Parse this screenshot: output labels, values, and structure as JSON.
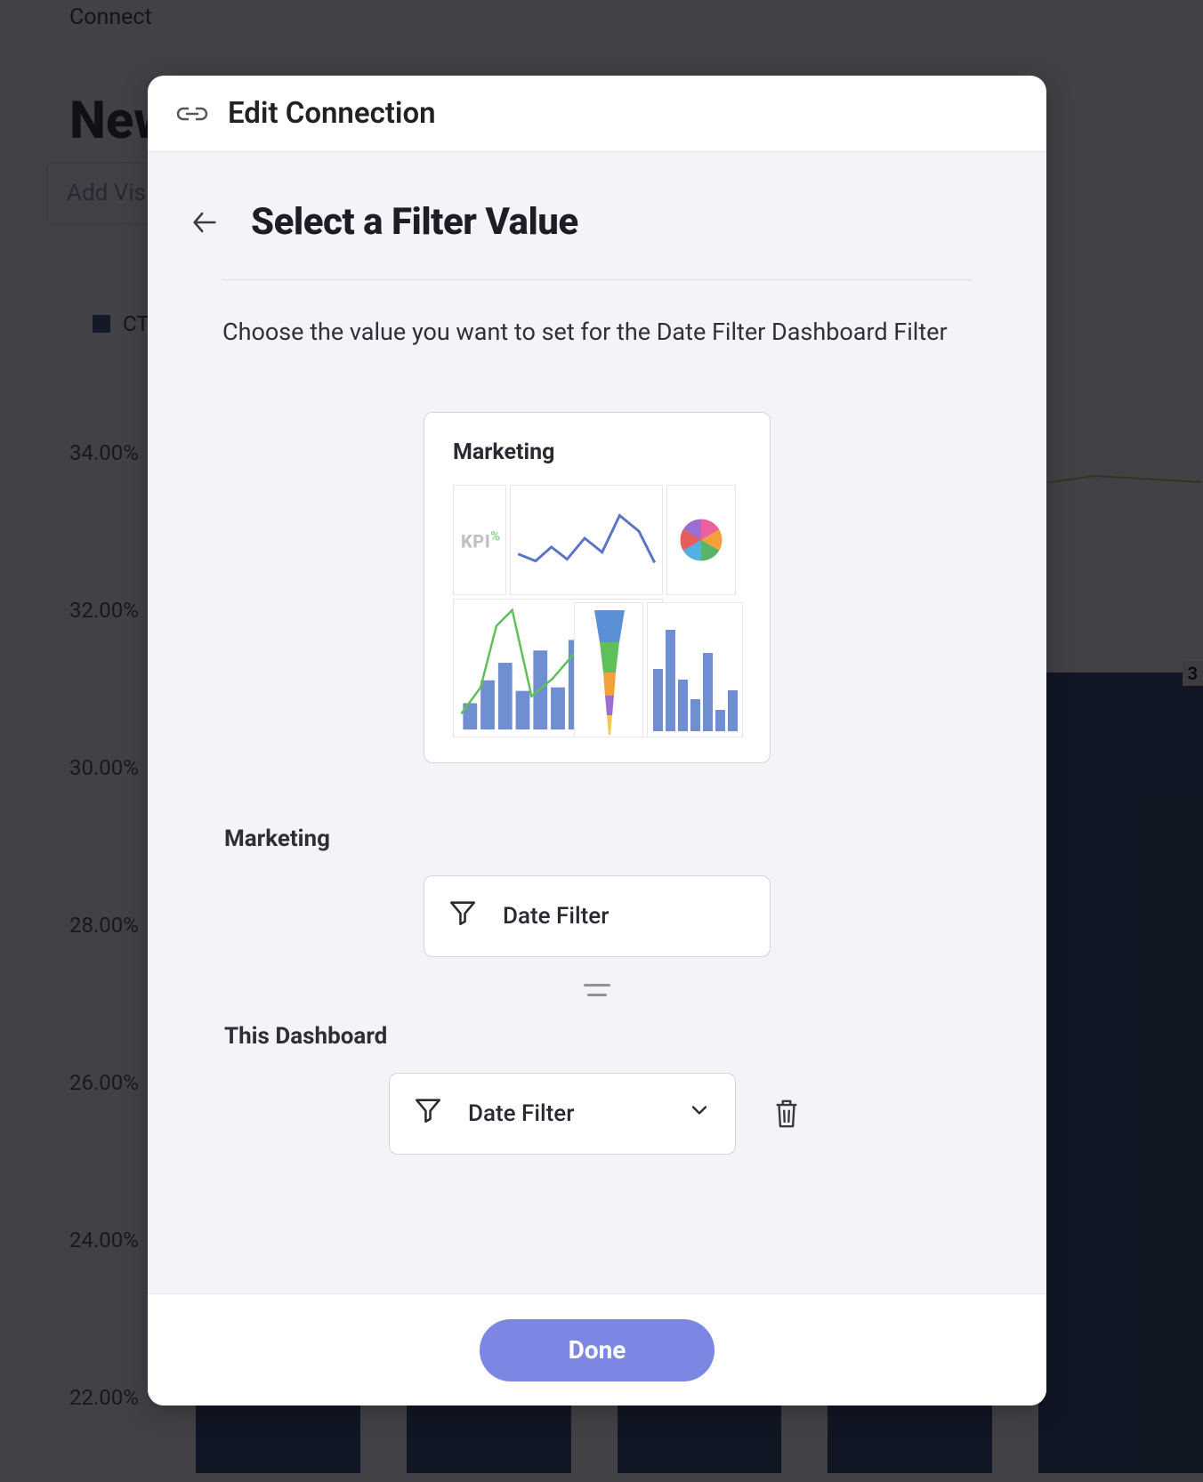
{
  "background": {
    "breadcrumb": "Connect",
    "page_title_partial": "New",
    "add_vis_placeholder": "Add Vis",
    "legend_label": "CT",
    "y_axis": [
      "34.00%",
      "32.00%",
      "30.00%",
      "28.00%",
      "26.00%",
      "24.00%",
      "22.00%"
    ],
    "badge": "3"
  },
  "modal": {
    "header_title": "Edit Connection",
    "section_title": "Select a Filter Value",
    "subtitle": "Choose the value you want to set for the Date Filter Dashboard Filter",
    "card_title": "Marketing",
    "kpi_label": "KPI",
    "source_group_label": "Marketing",
    "source_filter_name": "Date Filter",
    "target_group_label": "This Dashboard",
    "target_filter_name": "Date Filter",
    "done_label": "Done"
  }
}
